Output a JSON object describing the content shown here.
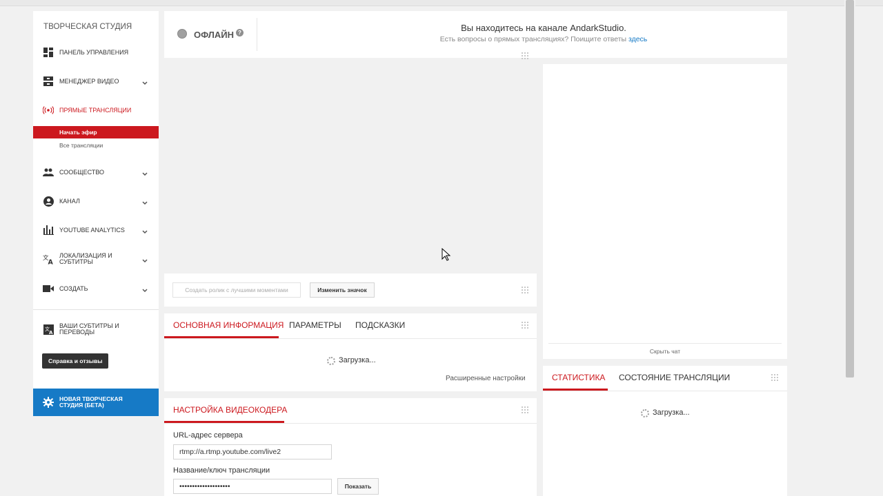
{
  "sidebar": {
    "title": "ТВОРЧЕСКАЯ СТУДИЯ",
    "items": [
      {
        "label": "Панель управления",
        "icon": "dashboard-icon"
      },
      {
        "label": "Менеджер видео",
        "icon": "video-manager-icon"
      },
      {
        "label": "Прямые трансляции",
        "icon": "live-broadcast-icon"
      },
      {
        "label": "Сообщество",
        "icon": "community-icon"
      },
      {
        "label": "Канал",
        "icon": "channel-icon"
      },
      {
        "label": "YouTube Analytics",
        "icon": "analytics-icon"
      },
      {
        "label_line1": "Локализация и",
        "label_line2": "субтитры",
        "icon": "translate-icon"
      },
      {
        "label": "Создать",
        "icon": "create-icon"
      },
      {
        "label_line1": "Ваши субтитры и",
        "label_line2": "переводы",
        "icon": "subtitles-icon"
      }
    ],
    "subitems": [
      "Начать эфир",
      "Все трансляции"
    ],
    "help_button": "Справка и отзывы",
    "beta_line1": "Новая творческая",
    "beta_line2": "студия (бета)"
  },
  "status": {
    "label": "ОФЛАЙН",
    "help": "?",
    "channel_message": "Вы находитесь на канале AndarkStudio.",
    "question_text": "Есть вопросы о прямых трансляциях? Поищите ответы ",
    "link_text": "здесь"
  },
  "actions": {
    "create_highlights": "Создать ролик с лучшими моментами",
    "change_thumbnail": "Изменить значок"
  },
  "info_tabs": [
    "Основная информация",
    "Параметры",
    "Подсказки"
  ],
  "loading_text": "Загрузка...",
  "advanced_settings": "Расширенные настройки",
  "encoder": {
    "title": "Настройка видеокодера",
    "server_url_label": "URL-адрес сервера",
    "server_url_value": "rtmp://a.rtmp.youtube.com/live2",
    "stream_key_label": "Название/ключ трансляции",
    "stream_key_value": "••••••••••••••••••••",
    "show_button": "Показать"
  },
  "chat": {
    "hide_chat": "Скрыть чат"
  },
  "stats_tabs": [
    "Статистика",
    "Состояние трансляции"
  ],
  "colors": {
    "accent_red": "#cc181e",
    "link_blue": "#167ac6",
    "offline_gray": "#a0a0a0"
  }
}
